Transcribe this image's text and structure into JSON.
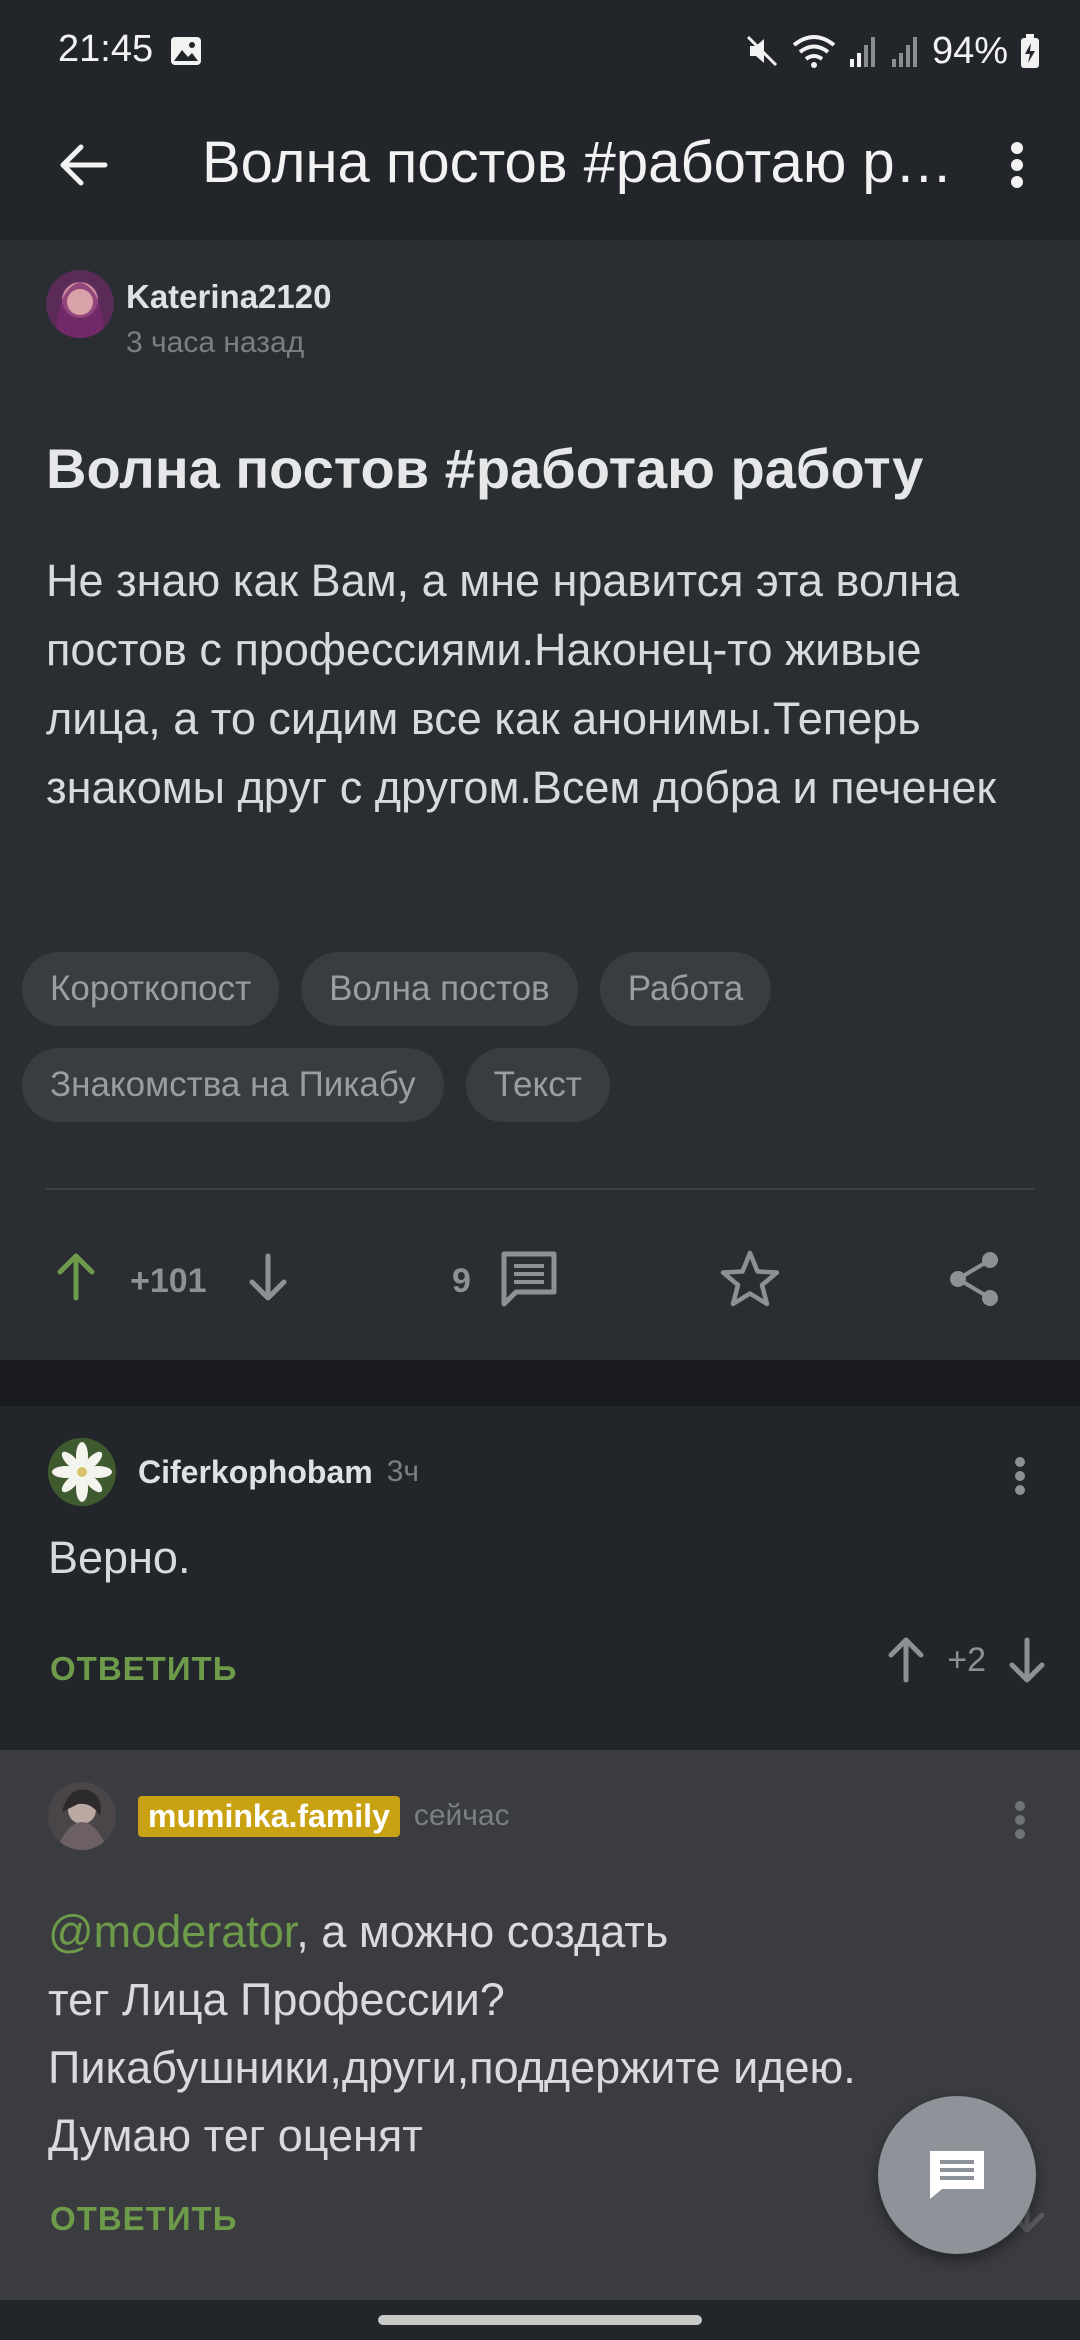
{
  "status_bar": {
    "time": "21:45",
    "battery": "94%",
    "icons": [
      "image-icon",
      "mute-icon",
      "wifi-icon",
      "signal-icon",
      "signal-icon",
      "battery-charging-icon"
    ]
  },
  "app_bar": {
    "title": "Волна постов #работаю работу",
    "back_icon": "arrow-left-icon",
    "menu_icon": "more-vert-icon"
  },
  "post": {
    "author": "Katerina2120",
    "time": "3 часа назад",
    "title": "Волна постов #работаю работу",
    "body": "Не знаю как Вам, а мне нравится эта волна постов с профессиями.Наконец-то живые лица, а то сидим все как анонимы.Теперь знакомы друг с другом.Всем добра и печенек",
    "tags": [
      "Короткопост",
      "Волна постов",
      "Работа",
      "Знакомства на Пикабу",
      "Текст"
    ],
    "rating": "+101",
    "comments_count": "9"
  },
  "comments": [
    {
      "author": "Ciferkophobam",
      "time": "3ч",
      "text": "Верно.",
      "reply_label": "ОТВЕТИТЬ",
      "rating": "+2"
    },
    {
      "author": "muminka.family",
      "time": "сейчас",
      "mention": "@moderator",
      "text_after_mention": ", а можно создать",
      "lines": [
        "тег Лица Профессии?",
        "Пикабушники,други,поддержите идею.",
        "Думаю тег оценят"
      ],
      "reply_label": "ОТВЕТИТЬ"
    }
  ],
  "colors": {
    "background": "#22252a",
    "post_background": "#2a2d32",
    "accent_green": "#6d9b4a",
    "badge_yellow": "#c9a213"
  }
}
